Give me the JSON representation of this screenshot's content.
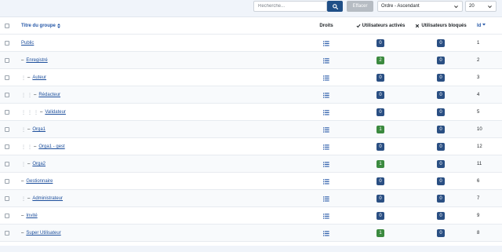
{
  "toolbar": {
    "search_placeholder": "Recherche...",
    "clear_label": "Effacer",
    "order_value": "Ordre - Ascendant",
    "limit_value": "20"
  },
  "table": {
    "headers": {
      "title": "Titre du groupe",
      "permissions": "Droits",
      "enabled": "Utilisateurs activés",
      "blocked": "Utilisateurs bloqués",
      "id": "Id"
    },
    "rows": [
      {
        "title": "Public",
        "level": 0,
        "enabled": "0",
        "blocked": "0",
        "id": "1"
      },
      {
        "title": "Enregistré",
        "level": 1,
        "enabled": "2",
        "blocked": "0",
        "id": "2"
      },
      {
        "title": "Auteur",
        "level": 2,
        "enabled": "0",
        "blocked": "0",
        "id": "3"
      },
      {
        "title": "Rédacteur",
        "level": 3,
        "enabled": "0",
        "blocked": "0",
        "id": "4"
      },
      {
        "title": "Validateur",
        "level": 4,
        "enabled": "0",
        "blocked": "0",
        "id": "5"
      },
      {
        "title": "Orga1",
        "level": 2,
        "enabled": "1",
        "blocked": "0",
        "id": "10"
      },
      {
        "title": "Orga1 - gest",
        "level": 3,
        "enabled": "0",
        "blocked": "0",
        "id": "12"
      },
      {
        "title": "Orga2",
        "level": 2,
        "enabled": "1",
        "blocked": "0",
        "id": "11"
      },
      {
        "title": "Gestionnaire",
        "level": 1,
        "enabled": "0",
        "blocked": "0",
        "id": "6"
      },
      {
        "title": "Administrateur",
        "level": 2,
        "enabled": "0",
        "blocked": "0",
        "id": "7"
      },
      {
        "title": "Invité",
        "level": 1,
        "enabled": "0",
        "blocked": "0",
        "id": "9"
      },
      {
        "title": "Super Utilisateur",
        "level": 1,
        "enabled": "1",
        "blocked": "0",
        "id": "8"
      }
    ]
  },
  "colors": {
    "badge_zero": "#2a4f83",
    "badge_positive": "#3b8a3f",
    "link": "#1d4f9c",
    "search_button": "#1f4f87"
  },
  "icons": {
    "search": "search-icon",
    "chevron": "chevron-down-icon",
    "sort": "sort-icon",
    "permissions": "list-icon",
    "enabled": "check-icon",
    "blocked": "times-icon"
  }
}
